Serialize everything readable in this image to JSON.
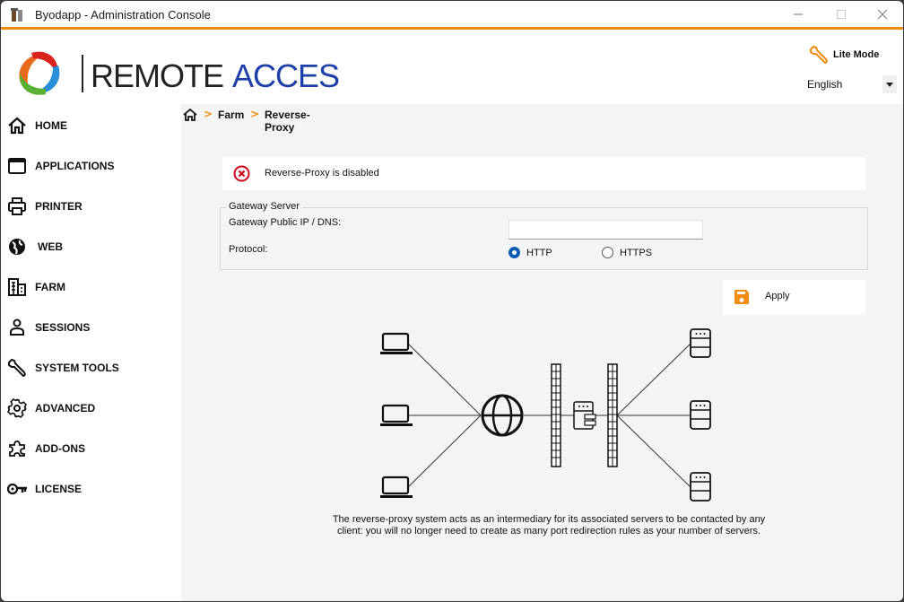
{
  "window": {
    "title": "Byodapp - Administration Console",
    "accent_color": "#f28c0f"
  },
  "header": {
    "logo_word1": "REMOTE",
    "logo_word2": "ACCES",
    "lite_mode_label": "Lite Mode",
    "language_selected": "English"
  },
  "sidebar": {
    "items": [
      {
        "label": "HOME",
        "icon": "home-icon"
      },
      {
        "label": "APPLICATIONS",
        "icon": "window-icon"
      },
      {
        "label": "PRINTER",
        "icon": "printer-icon"
      },
      {
        "label": "WEB",
        "icon": "globe-icon"
      },
      {
        "label": "FARM",
        "icon": "building-icon"
      },
      {
        "label": "SESSIONS",
        "icon": "user-icon"
      },
      {
        "label": "SYSTEM TOOLS",
        "icon": "wrench-icon"
      },
      {
        "label": "ADVANCED",
        "icon": "gear-icon"
      },
      {
        "label": "ADD-ONS",
        "icon": "puzzle-icon"
      },
      {
        "label": "LICENSE",
        "icon": "key-icon"
      }
    ]
  },
  "breadcrumb": {
    "items": [
      "Farm",
      "Reverse-Proxy"
    ]
  },
  "status": {
    "message": "Reverse-Proxy is disabled",
    "color": "#d0021b"
  },
  "gateway": {
    "legend": "Gateway Server",
    "ip_label": "Gateway Public IP / DNS:",
    "ip_value": "",
    "protocol_label": "Protocol:",
    "protocols": [
      {
        "label": "HTTP",
        "selected": true
      },
      {
        "label": "HTTPS",
        "selected": false
      }
    ]
  },
  "apply_label": "Apply",
  "description": "The reverse-proxy system acts as an intermediary for its associated servers to be contacted by any client: you will no longer need to create as many port redirection rules as your number of servers."
}
